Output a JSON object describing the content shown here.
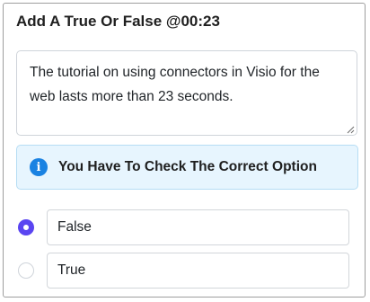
{
  "question": {
    "title": "Add A True Or False @00:23",
    "statement": "The tutorial on using connectors in Visio for the web lasts more than 23 seconds."
  },
  "alert": {
    "icon": "info-icon",
    "message": "You Have To Check The Correct Option"
  },
  "options": [
    {
      "label": "False",
      "selected": true
    },
    {
      "label": "True",
      "selected": false
    }
  ],
  "colors": {
    "accent": "#5a45f1",
    "info": "#1a82e2",
    "alert_bg": "#e7f5fe"
  }
}
